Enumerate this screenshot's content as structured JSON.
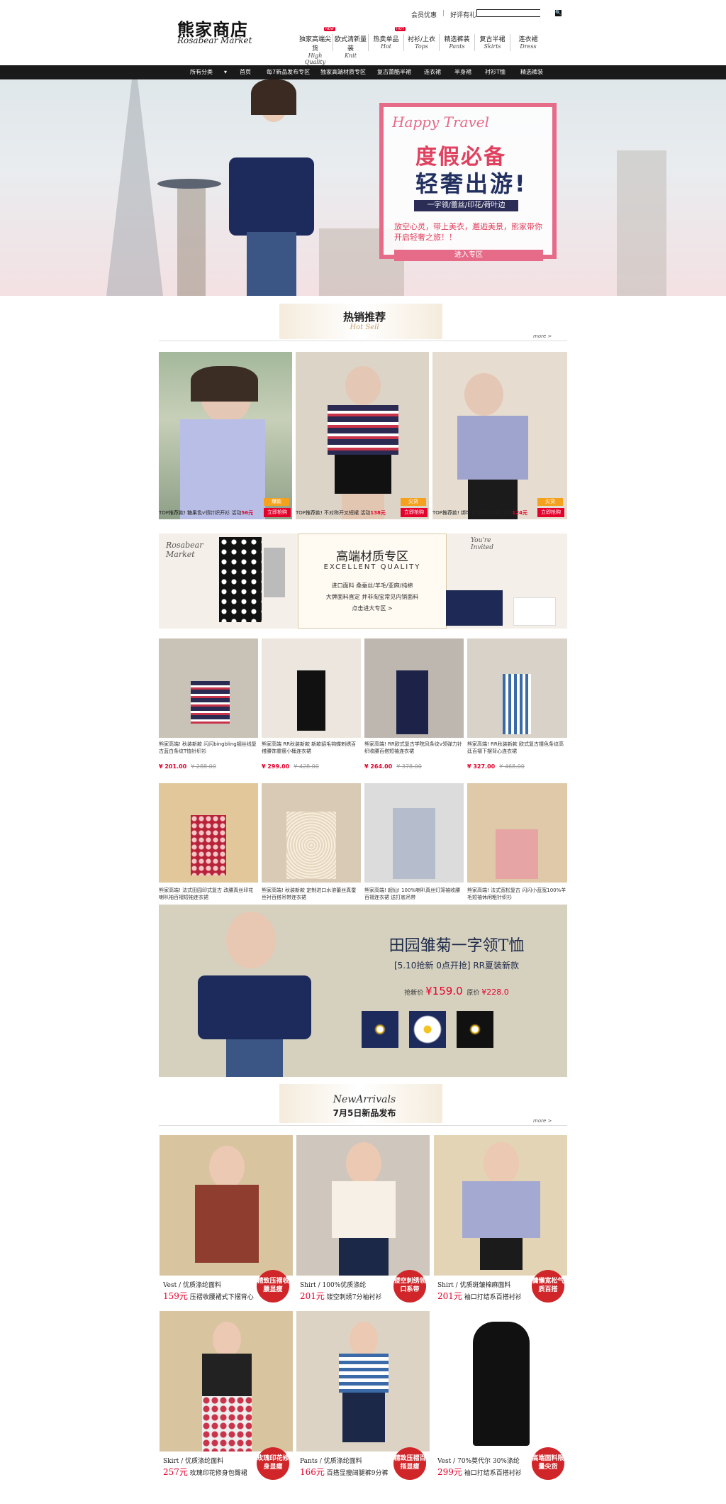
{
  "header": {
    "logo_cn": "熊家商店",
    "logo_en": "Rosabear Market",
    "links": [
      "会员优惠",
      "好评有礼"
    ],
    "search_placeholder": "",
    "search_btn": "🔍",
    "nav": [
      {
        "cn": "独家高端尖货",
        "en": "High Quality",
        "new": "NEW"
      },
      {
        "cn": "欧式清新量装",
        "en": "Knit",
        "new": ""
      },
      {
        "cn": "热卖单品",
        "en": "Hot",
        "new": "HOT"
      },
      {
        "cn": "衬衫/上衣",
        "en": "Tops",
        "new": ""
      },
      {
        "cn": "精选裤装",
        "en": "Pants",
        "new": ""
      },
      {
        "cn": "复古半裙",
        "en": "Skirts",
        "new": ""
      },
      {
        "cn": "连衣裙",
        "en": "Dress",
        "new": ""
      }
    ]
  },
  "catbar": [
    "所有分类",
    "▾",
    "首页",
    "每7新品发布专区",
    "独家高端材质专区",
    "复古蕾酷半裙",
    "连衣裙",
    "半身裙",
    "衬衫T恤",
    "精选裤装"
  ],
  "banner": {
    "script": "Happy Travel",
    "title1": "度假必备",
    "title2": "轻奢出游!",
    "tag": "一字领/蕾丝/印花/荷叶边",
    "desc": "放空心灵，带上美衣，邂逅美景，熊家带你开启轻奢之旅！！",
    "btn": "进入专区"
  },
  "hot": {
    "title": "热销推荐",
    "sub": "Hot Sell",
    "more": "more >",
    "items": [
      {
        "badge": "爆款",
        "cap": "TOP推荐款! 糖果色v领针织开衫 活动",
        "price": "56元",
        "btn": "立即抢购"
      },
      {
        "badge": "尖货",
        "cap": "TOP推荐款! 不对称开叉短裙 活动",
        "price": "138元",
        "btn": "立即抢购"
      },
      {
        "badge": "尖货",
        "cap": "TOP推荐款! 绑带收腰条纹衬衫 活动",
        "price": "124元",
        "btn": "立即抢购"
      }
    ]
  },
  "quality": {
    "script1": "Rosabear Market",
    "title": "高端材质专区",
    "en": "EXCELLENT QUALITY",
    "l1": "进口面料  桑蚕丝/羊毛/亚麻/纯棉",
    "l2": "大牌面料直定  并非淘宝常见内销面料",
    "l3": "点击进大专区 >",
    "script2": "You're Invited"
  },
  "grid1": [
    {
      "cap": "熊家高端! 秋装新款 闪闪bingbling钢丝线复古蓝白条纹T恤针织衫",
      "now": "¥ 201.00",
      "old": "¥ 288.00"
    },
    {
      "cap": "熊家高端 RR秋装新款 新款貂毛钩蝶刺绣百搭腰饰重瘦小桶连衣裙",
      "now": "¥ 299.00",
      "old": "¥ 428.00"
    },
    {
      "cap": "熊家高端! RR欧式复古学院风条纹v领弹力针织收腰百搭短袖连衣裙",
      "now": "¥ 264.00",
      "old": "¥ 378.00"
    },
    {
      "cap": "熊家高端! RR秋装新款 欧式复古撞色条纹高廷百褶下摆背心连衣裙",
      "now": "¥ 327.00",
      "old": "¥ 468.00"
    }
  ],
  "grid2": [
    {
      "cap": "熊家高端! 法式田园印式复古 改腰真丝印花喇叭袖百褶短袖连衣裙"
    },
    {
      "cap": "熊家高端! 秋装新款 定制进口水溶蕾丝真蚕丝衬百搭吊带连衣裙"
    },
    {
      "cap": "熊家高端! 超仙! 100%喇叭真丝灯笼袖收腰百褶连衣裙 送打底吊带"
    },
    {
      "cap": "熊家高端! 法式宽松复古 闪闪小蓝宽100%羊毛短袖休闲粗针织衫"
    }
  ],
  "promo": {
    "title": "田园雏菊一字领T恤",
    "sub": "[5.10抢新 0点开抢] RR夏装新款",
    "pre_label": "抢新价",
    "pre_price": "¥159.0",
    "orig_label": "原价",
    "orig_price": "¥228.0"
  },
  "newarrivals": {
    "script": "NewArrivals",
    "title": "7月5日新品发布",
    "more": "more >",
    "items": [
      {
        "l1": "Vest / 优质涤纶面料",
        "price": "159元",
        "desc": "压褶收腰裙式下摆背心",
        "circ": "精致压褶收腰显瘦"
      },
      {
        "l1": "Shirt / 100%优质涤纶",
        "price": "201元",
        "desc": "镂空刺绣7分袖衬衫",
        "circ": "镂空刺绣领口系带"
      },
      {
        "l1": "Shirt / 优质斑皱棉麻面料",
        "price": "201元",
        "desc": "袖口打结系百搭衬衫",
        "circ": "慵懒宽松气质百搭"
      },
      {
        "l1": "Skirt / 优质涤纶面料",
        "price": "257元",
        "desc": "玫瑰印花修身包臀裙",
        "circ": "玫瑰印花修身显瘦"
      },
      {
        "l1": "Pants / 优质涤纶面料",
        "price": "166元",
        "desc": "百搭显瘦阔腿裤9分裤",
        "circ": "精致压褶百搭显瘦"
      },
      {
        "l1": "Vest / 70%莫代尔 30%涤纶",
        "price": "299元",
        "desc": "袖口打结系百搭衬衫",
        "circ": "高端面料限量尖货"
      }
    ]
  }
}
